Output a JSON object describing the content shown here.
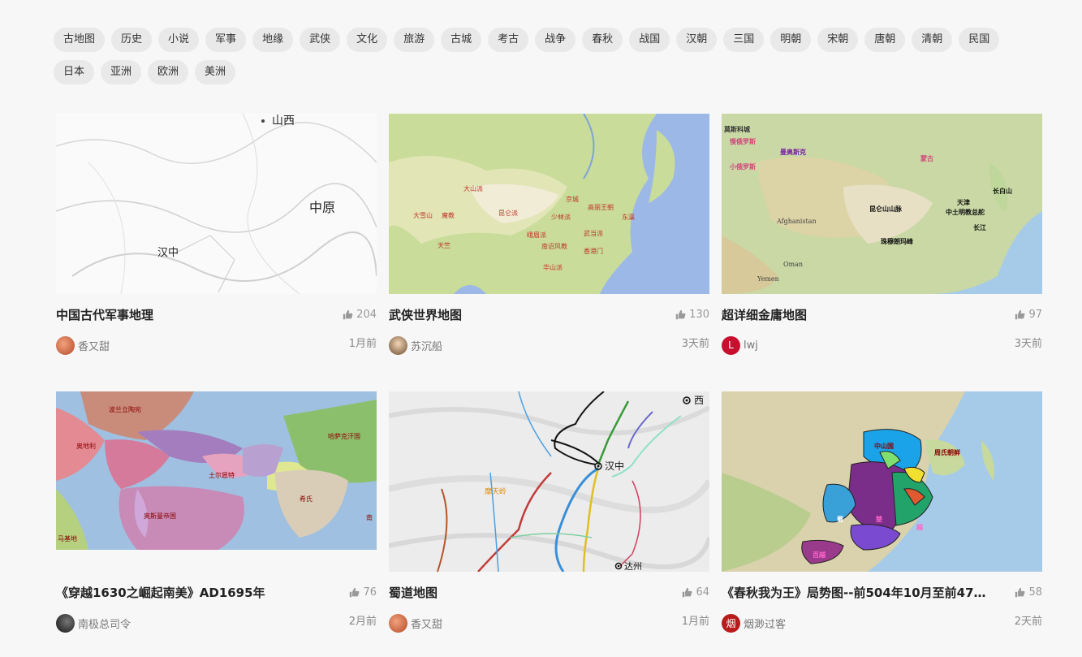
{
  "tags": [
    "古地图",
    "历史",
    "小说",
    "军事",
    "地缘",
    "武侠",
    "文化",
    "旅游",
    "古城",
    "考古",
    "战争",
    "春秋",
    "战国",
    "汉朝",
    "三国",
    "明朝",
    "宋朝",
    "唐朝",
    "清朝",
    "民国",
    "日本",
    "亚洲",
    "欧洲",
    "美洲"
  ],
  "cards": [
    {
      "title": "中国古代军事地理",
      "likes": "204",
      "author": "香又甜",
      "time": "1月前",
      "map_labels": [
        "山西",
        "中原",
        "汉中"
      ]
    },
    {
      "title": "武侠世界地图",
      "likes": "130",
      "author": "苏沉船",
      "time": "3天前",
      "map_labels": [
        "大山派",
        "昆仑派",
        "京城",
        "高丽王朝",
        "东瀛",
        "少林派",
        "武当派",
        "峨眉派",
        "南诏风教",
        "香港门",
        "大雪山",
        "天竺",
        "魔教",
        "华山派"
      ]
    },
    {
      "title": "超详细金庸地图",
      "likes": "97",
      "author": "lwj",
      "author_initial": "L",
      "time": "3天前",
      "map_labels": [
        "莫斯科城",
        "慢俄罗斯",
        "曼奥斯克",
        "小俄罗斯",
        "蒙古",
        "长白山",
        "天津",
        "昆仑山山脉",
        "中土明教总舵",
        "长江",
        "珠穆朗玛峰",
        "Afghanistan",
        "Yemen",
        "Oman"
      ]
    },
    {
      "title": "《穿越1630之崛起南美》AD1695年",
      "likes": "76",
      "author": "南极总司令",
      "time": "2月前",
      "map_labels": [
        "波兰立陶宛",
        "奥地利",
        "土尔扈特",
        "哈萨克汗国",
        "奥斯曼帝国",
        "希氏",
        "马基地",
        "南"
      ]
    },
    {
      "title": "蜀道地图",
      "likes": "64",
      "author": "香又甜",
      "time": "1月前",
      "map_labels": [
        "西",
        "汉中",
        "摩天岭",
        "达州"
      ]
    },
    {
      "title": "《春秋我为王》局势图--前504年10月至前475年...",
      "likes": "58",
      "author": "烟渺过客",
      "author_initial": "烟",
      "time": "2天前",
      "map_labels": [
        "中山国",
        "周氏朝鲜",
        "蜀",
        "楚",
        "越",
        "百越"
      ]
    }
  ],
  "colors": {
    "bg": "#f7f7f7",
    "tag_bg": "#e9e9e9",
    "lwj_avatar": "#c8102e",
    "yan_avatar": "#b71c1c"
  }
}
